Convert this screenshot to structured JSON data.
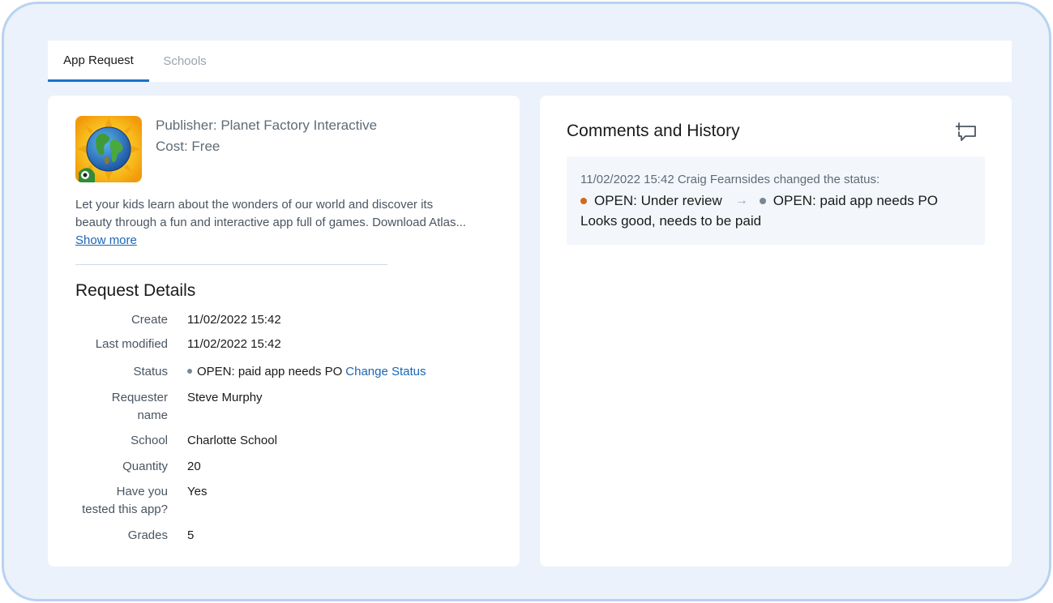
{
  "tabs": [
    {
      "label": "App Request",
      "active": true
    },
    {
      "label": "Schools",
      "active": false
    }
  ],
  "app": {
    "icon": "globe-app-icon",
    "publisher": "Publisher: Planet Factory Interactive",
    "cost": "Cost: Free",
    "description_lines": [
      "Let your kids learn about the wonders of our world and discover its",
      "beauty through a fun and interactive app full of games. Download Atlas..."
    ],
    "show_more": "Show more"
  },
  "request_details": {
    "title": "Request Details",
    "rows": [
      {
        "label": "Create",
        "value": "11/02/2022 15:42"
      },
      {
        "label": "Last modified",
        "value": "11/02/2022 15:42"
      },
      {
        "label": "Status",
        "value": "OPEN: paid app needs PO",
        "action": "Change Status"
      },
      {
        "label_lines": [
          "Requester",
          "name"
        ],
        "value": "Steve Murphy"
      },
      {
        "label": "School",
        "value": "Charlotte School"
      },
      {
        "label": "Quantity",
        "value": "20"
      },
      {
        "label_lines": [
          "Have you",
          "tested this app?"
        ],
        "value": "Yes"
      },
      {
        "label": "Grades",
        "value": "5"
      }
    ]
  },
  "comments": {
    "title": "Comments and History",
    "add_icon": "add-comment-icon",
    "entries": [
      {
        "meta": "11/02/2022 15:42 Craig Fearnsides changed the status:",
        "from_status": "OPEN: Under review",
        "arrow": "→",
        "to_status": "OPEN: paid app needs PO",
        "note": "Looks good, needs to be paid"
      }
    ]
  },
  "colors": {
    "accent": "#1a73c8",
    "link": "#1a66b3",
    "frame_border": "#b8d3f1",
    "background": "#ebf2fb",
    "status_review": "#d4691c",
    "status_neutral": "#7a8794"
  }
}
